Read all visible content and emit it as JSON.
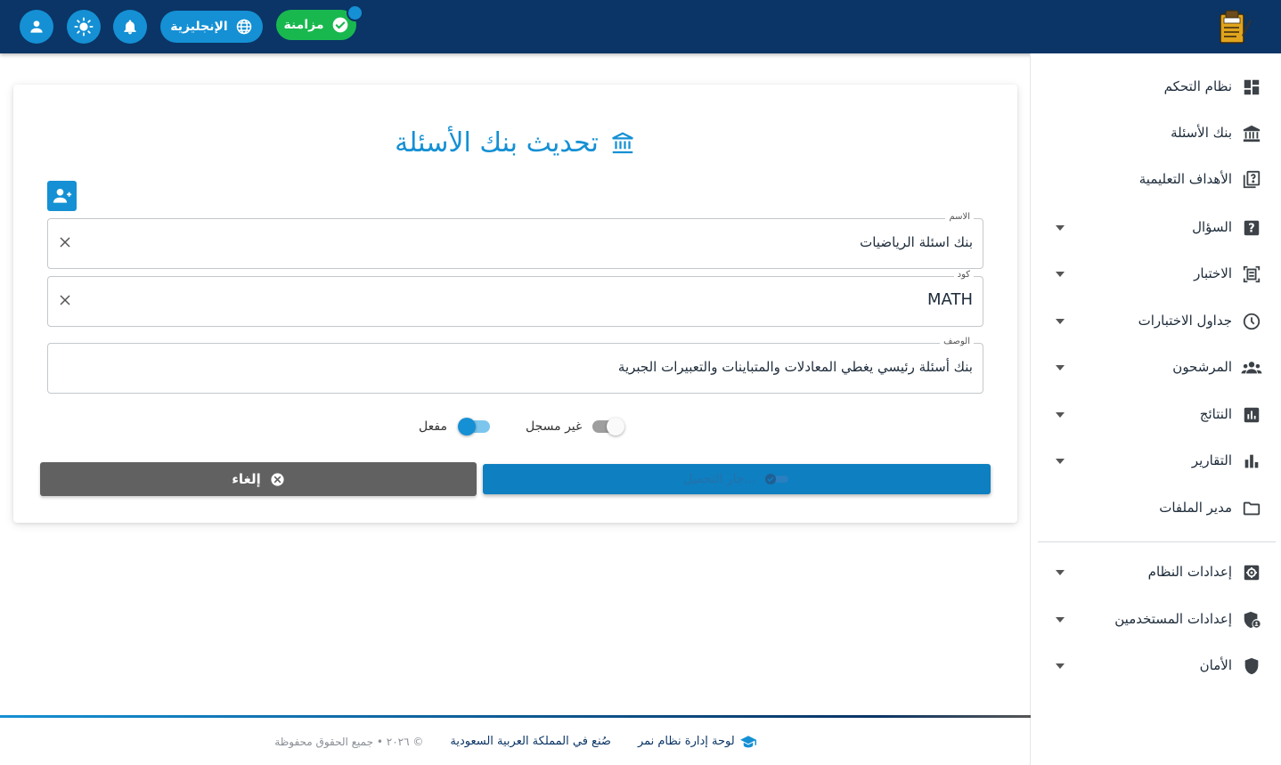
{
  "header": {
    "sync_label": "مزامنة",
    "language_label": "الإنجليزية",
    "icons": [
      "user-icon",
      "brightness-icon",
      "bell-icon",
      "globe-icon",
      "check-circle-icon"
    ]
  },
  "sidebar": {
    "items": [
      {
        "label": "نظام التحكم",
        "icon": "dashboard-icon",
        "expandable": false
      },
      {
        "label": "بنك الأسئلة",
        "icon": "bank-icon",
        "expandable": false
      },
      {
        "label": "الأهداف التعليمية",
        "icon": "book-question-icon",
        "expandable": false
      },
      {
        "label": "السؤال",
        "icon": "question-box-icon",
        "expandable": true
      },
      {
        "label": "الاختبار",
        "icon": "exam-scan-icon",
        "expandable": true
      },
      {
        "label": "جداول الاختبارات",
        "icon": "clock-icon",
        "expandable": true
      },
      {
        "label": "المرشحون",
        "icon": "people-icon",
        "expandable": true
      },
      {
        "label": "النتائج",
        "icon": "poll-box-icon",
        "expandable": true
      },
      {
        "label": "التقارير",
        "icon": "bar-chart-icon",
        "expandable": true
      },
      {
        "label": "مدير الملفات",
        "icon": "folder-icon",
        "expandable": false
      },
      {
        "label": "إعدادات النظام",
        "icon": "settings-box-icon",
        "expandable": true
      },
      {
        "label": "إعدادات المستخدمين",
        "icon": "user-shield-icon",
        "expandable": true
      },
      {
        "label": "الأمان",
        "icon": "shield-icon",
        "expandable": true
      }
    ]
  },
  "form": {
    "title": "تحديث بنك الأسئلة",
    "fields": {
      "name": {
        "label": "الاسم",
        "value": "بنك اسئلة الرياضيات"
      },
      "code": {
        "label": "كود",
        "value": "MATH"
      },
      "description": {
        "label": "الوصف",
        "value": "بنك أسئلة رئيسي يغطي المعادلات والمتباينات والتعبيرات الجبرية"
      }
    },
    "toggles": {
      "registered": {
        "label": "غير مسجل",
        "on": false
      },
      "active": {
        "label": "مفعل",
        "on": true
      }
    },
    "save_label": "جار التحميل...",
    "cancel_label": "إلغاء"
  },
  "footer": {
    "brand": "لوحة إدارة نظام نمر",
    "made_in": "صُنع في المملكة العربية السعودية",
    "copyright": "© ٢٠٢٦ • جميع الحقوق محفوظة"
  },
  "colors": {
    "topbar": "#0a3566",
    "accent": "#1590d4",
    "success": "#19b84f",
    "cancel": "#616161"
  }
}
